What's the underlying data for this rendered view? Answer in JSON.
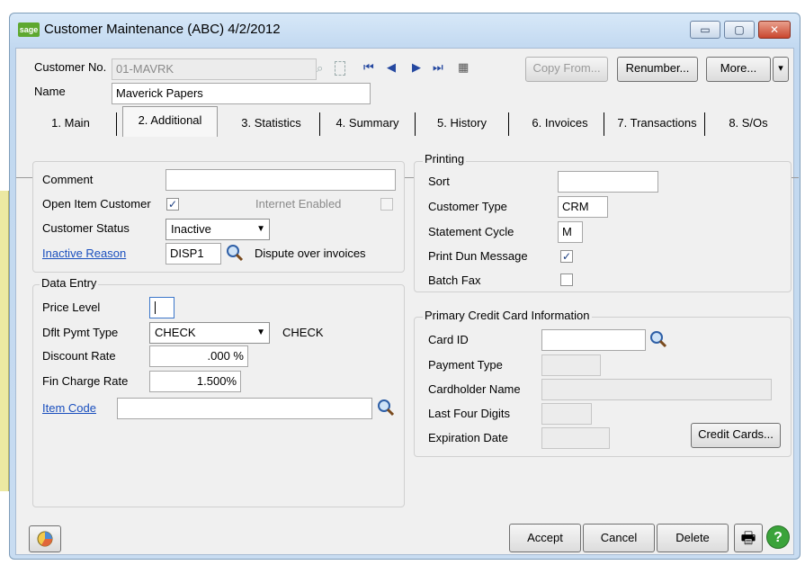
{
  "window": {
    "app_icon_text": "sage",
    "title": "Customer Maintenance (ABC) 4/2/2012",
    "minimize": "▭",
    "maximize": "▢",
    "close": "✕"
  },
  "header": {
    "customer_no_label": "Customer No.",
    "customer_no_value": "01-MAVRK",
    "name_label": "Name",
    "name_value": "Maverick Papers",
    "copy_from": "Copy From...",
    "renumber": "Renumber...",
    "more": "More...",
    "more_dropdown": "▾",
    "nav_icons": [
      "⏮",
      "◀",
      "▶",
      "⏭",
      "▦"
    ]
  },
  "tabs": [
    {
      "label": "1. Main"
    },
    {
      "label": "2. Additional"
    },
    {
      "label": "3. Statistics"
    },
    {
      "label": "4. Summary"
    },
    {
      "label": "5. History"
    },
    {
      "label": "6. Invoices"
    },
    {
      "label": "7. Transactions"
    },
    {
      "label": "8. S/Os"
    }
  ],
  "general": {
    "comment_label": "Comment",
    "comment_value": "",
    "open_item_label": "Open Item Customer",
    "open_item_checked": "✓",
    "internet_enabled_label": "Internet Enabled",
    "status_label": "Customer Status",
    "status_value": "Inactive",
    "inactive_reason_label": "Inactive Reason",
    "inactive_reason_code": "DISP1",
    "inactive_reason_desc": "Dispute over invoices"
  },
  "data_entry": {
    "legend": "Data Entry",
    "price_level_label": "Price Level",
    "price_level_value": "",
    "dflt_pymt_label": "Dflt Pymt Type",
    "dflt_pymt_value": "CHECK",
    "dflt_pymt_desc": "CHECK",
    "discount_label": "Discount Rate",
    "discount_value": ".000 %",
    "fin_charge_label": "Fin Charge Rate",
    "fin_charge_value": "1.500%",
    "item_code_label": "Item Code",
    "item_code_value": ""
  },
  "printing": {
    "legend": "Printing",
    "sort_label": "Sort",
    "sort_value": "",
    "customer_type_label": "Customer Type",
    "customer_type_value": "CRM",
    "statement_cycle_label": "Statement Cycle",
    "statement_cycle_value": "M",
    "print_dun_label": "Print Dun Message",
    "print_dun_checked": "✓",
    "batch_fax_label": "Batch Fax"
  },
  "credit_card": {
    "legend": "Primary Credit Card Information",
    "card_id_label": "Card ID",
    "payment_type_label": "Payment Type",
    "cardholder_label": "Cardholder Name",
    "last_four_label": "Last Four Digits",
    "expiration_label": "Expiration Date",
    "credit_cards_button": "Credit Cards..."
  },
  "footer": {
    "accept": "Accept",
    "cancel": "Cancel",
    "delete": "Delete",
    "print_icon": "🖶",
    "help_icon": "?"
  },
  "colors": {
    "link": "#1a4fbe",
    "title_bg": "#c8dcf1",
    "close_button": "#c9472f"
  }
}
